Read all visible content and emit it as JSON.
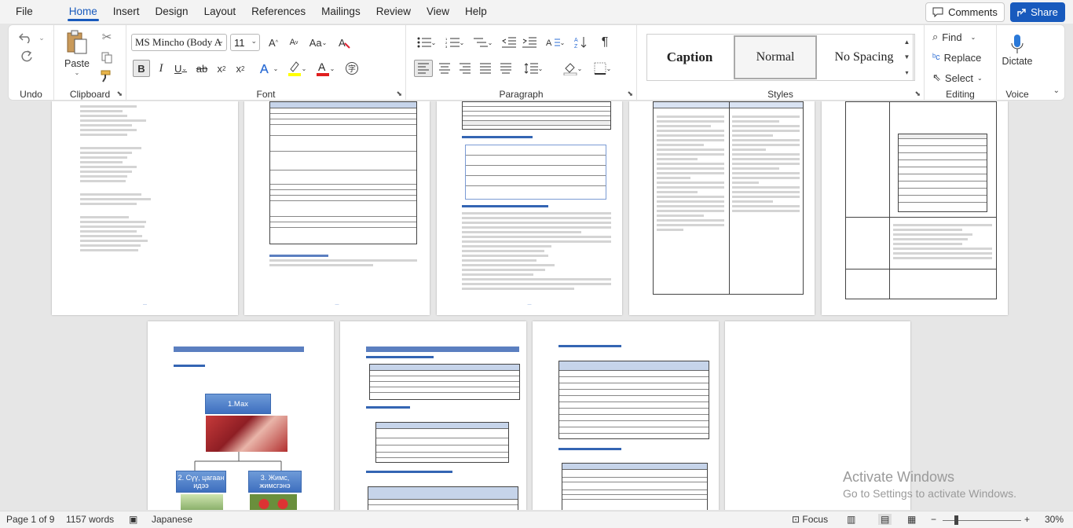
{
  "menu": {
    "tabs": [
      "File",
      "Home",
      "Insert",
      "Design",
      "Layout",
      "References",
      "Mailings",
      "Review",
      "View",
      "Help"
    ],
    "active": "Home",
    "comments": "Comments",
    "share": "Share"
  },
  "ribbon": {
    "undo": {
      "label": "Undo"
    },
    "clipboard": {
      "label": "Clipboard",
      "paste": "Paste"
    },
    "font": {
      "label": "Font",
      "family": "MS Mincho (Body A",
      "size": "11"
    },
    "paragraph": {
      "label": "Paragraph"
    },
    "styles": {
      "label": "Styles",
      "items": [
        "Caption",
        "Normal",
        "No Spacing"
      ],
      "selected": "Normal"
    },
    "editing": {
      "label": "Editing",
      "find": "Find",
      "replace": "Replace",
      "select": "Select"
    },
    "voice": {
      "label": "Voice",
      "dictate": "Dictate"
    }
  },
  "document": {
    "page2_diagram": {
      "top": "1.Мах",
      "left": "2. Сүү, цагаан идээ",
      "right": "3. Жимс, жимсгэнэ"
    }
  },
  "status": {
    "page": "Page 1 of 9",
    "words": "1157 words",
    "language": "Japanese",
    "focus": "Focus",
    "zoom": "30%"
  },
  "watermark": {
    "line1": "Activate Windows",
    "line2": "Go to Settings to activate Windows."
  }
}
